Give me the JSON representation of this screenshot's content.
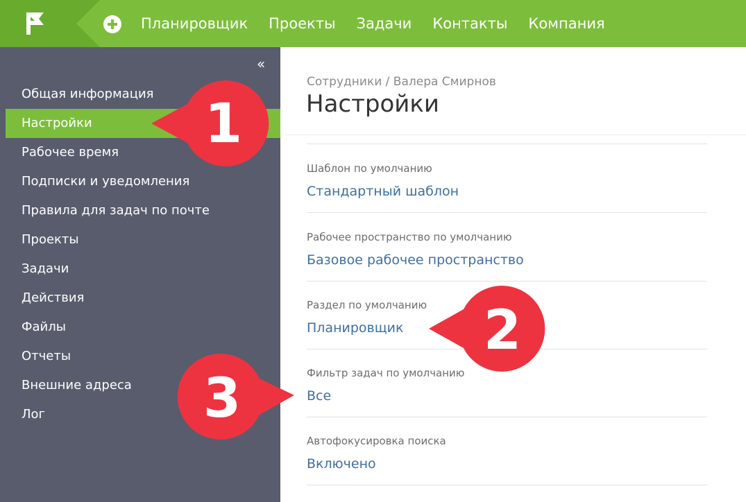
{
  "topbar": {
    "nav": [
      "Планировщик",
      "Проекты",
      "Задачи",
      "Контакты",
      "Компания"
    ],
    "accent": "#7cbe3c",
    "logo_icon": "flag-icon",
    "add_icon": "plus-circle-icon"
  },
  "sidebar": {
    "collapse_icon": "double-chevron-left-icon",
    "collapse_glyph": "«",
    "active_index": 1,
    "items": [
      "Общая информация",
      "Настройки",
      "Рабочее время",
      "Подписки и уведомления",
      "Правила для задач по почте",
      "Проекты",
      "Задачи",
      "Действия",
      "Файлы",
      "Отчеты",
      "Внешние адреса",
      "Лог"
    ]
  },
  "main": {
    "breadcrumb": "Сотрудники / Валера Смирнов",
    "title": "Настройки",
    "fields": [
      {
        "label": "Шаблон по умолчанию",
        "value": "Стандартный шаблон"
      },
      {
        "label": "Рабочее пространство по умолчанию",
        "value": "Базовое рабочее пространство"
      },
      {
        "label": "Раздел по умолчанию",
        "value": "Планировщик"
      },
      {
        "label": "Фильтр задач по умолчанию",
        "value": "Все"
      },
      {
        "label": "Автофокусировка поиска",
        "value": "Включено"
      }
    ]
  },
  "callouts": [
    {
      "number": "1",
      "color": "#ee3340"
    },
    {
      "number": "2",
      "color": "#ee3340"
    },
    {
      "number": "3",
      "color": "#ee3340"
    }
  ]
}
